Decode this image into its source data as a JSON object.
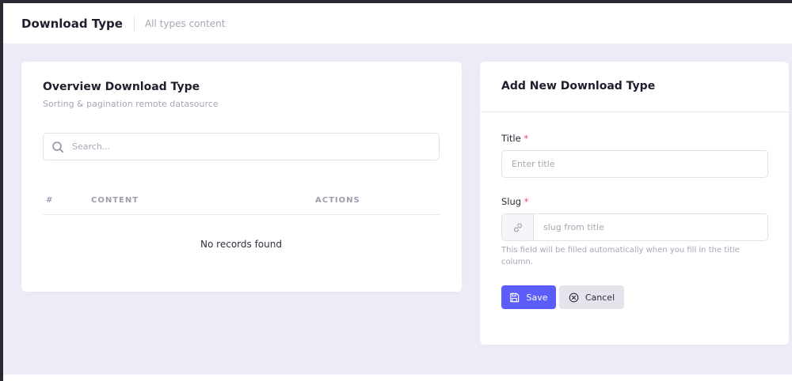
{
  "header": {
    "title": "Download Type",
    "subtitle": "All types content"
  },
  "overview": {
    "title": "Overview Download Type",
    "subtitle": "Sorting & pagination remote datasource",
    "search": {
      "placeholder": "Search...",
      "value": ""
    },
    "table": {
      "columns": [
        "#",
        "CONTENT",
        "ACTIONS"
      ],
      "rows": [],
      "empty_message": "No records found"
    }
  },
  "form": {
    "title": "Add New Download Type",
    "fields": {
      "title": {
        "label": "Title",
        "required_mark": "*",
        "placeholder": "Enter title",
        "value": ""
      },
      "slug": {
        "label": "Slug",
        "required_mark": "*",
        "placeholder": "slug from title",
        "value": "",
        "help": "This field will be filled automatically when you fill in the title column."
      }
    },
    "buttons": {
      "save": "Save",
      "cancel": "Cancel"
    }
  },
  "icons": {
    "search": "search-icon",
    "link": "link-icon",
    "save": "save-icon",
    "cancel": "cancel-circle-icon"
  },
  "colors": {
    "accent": "#5b5efb",
    "required": "#f1416c",
    "background": "#eeedf7"
  }
}
